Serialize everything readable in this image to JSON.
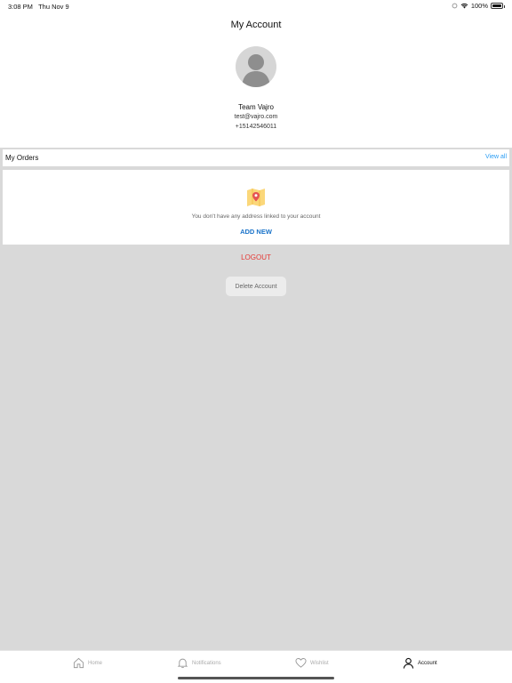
{
  "status_bar": {
    "time": "3:08 PM",
    "date": "Thu Nov 9",
    "battery": "100%"
  },
  "header": {
    "title": "My Account"
  },
  "profile": {
    "name": "Team Vajro",
    "email": "test@vajro.com",
    "phone": "+15142546011"
  },
  "orders": {
    "title": "My Orders",
    "view_all": "View all"
  },
  "address": {
    "empty_message": "You don't have any address linked to your account",
    "add_new": "ADD NEW"
  },
  "actions": {
    "logout": "LOGOUT",
    "delete_account": "Delete Account"
  },
  "tabbar": {
    "items": [
      {
        "label": "Home",
        "icon": "home-icon",
        "active": false
      },
      {
        "label": "Notifications",
        "icon": "bell-icon",
        "active": false
      },
      {
        "label": "Wishlist",
        "icon": "heart-icon",
        "active": false
      },
      {
        "label": "Account",
        "icon": "person-icon",
        "active": true
      }
    ]
  },
  "colors": {
    "accent": "#2a9df4",
    "add_new": "#1a73c9",
    "logout": "#e53935",
    "background": "#d9d9d9"
  }
}
